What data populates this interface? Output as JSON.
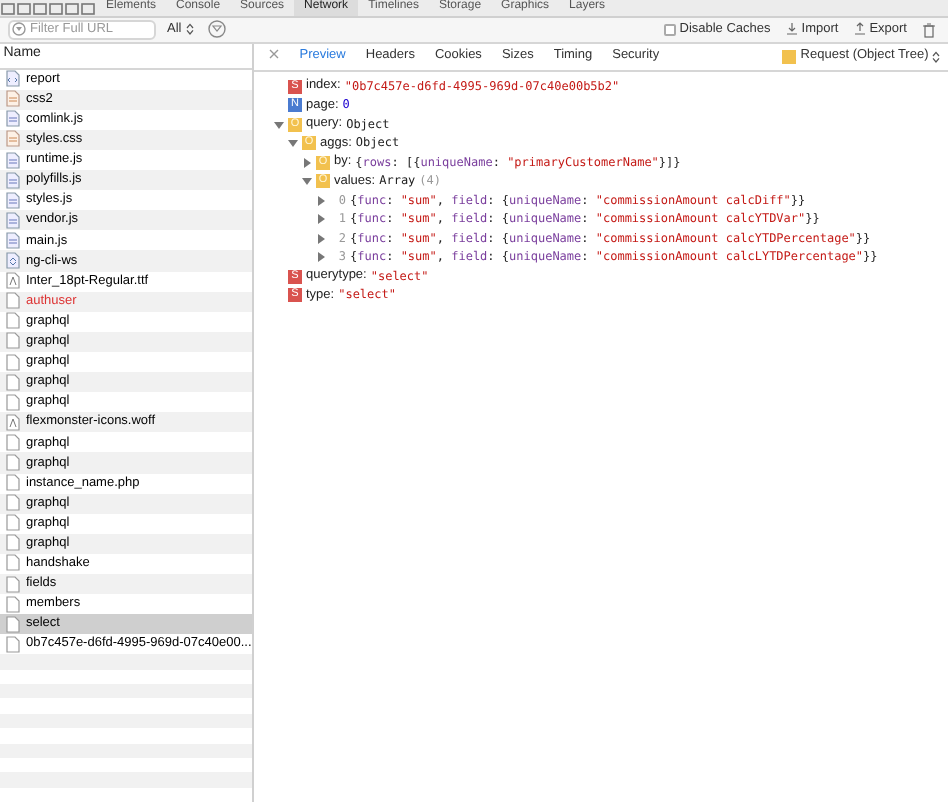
{
  "top_tabs": [
    {
      "label": "Elements",
      "selected": false
    },
    {
      "label": "Console",
      "selected": false
    },
    {
      "label": "Sources",
      "selected": false
    },
    {
      "label": "Network",
      "selected": true
    },
    {
      "label": "Timelines",
      "selected": false
    },
    {
      "label": "Storage",
      "selected": false
    },
    {
      "label": "Graphics",
      "selected": false
    },
    {
      "label": "Layers",
      "selected": false
    }
  ],
  "toolbar": {
    "filter": {
      "placeholder": "Filter Full URL"
    },
    "type_select": "All",
    "disable_caches": {
      "label": "Disable Caches",
      "checked": false
    },
    "import": "Import",
    "export": "Export"
  },
  "requests_header": "Name",
  "requests": [
    {
      "name": "report",
      "kind": "doc",
      "failed": false,
      "selected": false
    },
    {
      "name": "css2",
      "kind": "css",
      "failed": false,
      "selected": false
    },
    {
      "name": "comlink.js",
      "kind": "js",
      "failed": false,
      "selected": false
    },
    {
      "name": "styles.css",
      "kind": "css",
      "failed": false,
      "selected": false
    },
    {
      "name": "runtime.js",
      "kind": "js",
      "failed": false,
      "selected": false
    },
    {
      "name": "polyfills.js",
      "kind": "js",
      "failed": false,
      "selected": false
    },
    {
      "name": "styles.js",
      "kind": "js",
      "failed": false,
      "selected": false
    },
    {
      "name": "vendor.js",
      "kind": "js",
      "failed": false,
      "selected": false
    },
    {
      "name": "main.js",
      "kind": "js",
      "failed": false,
      "selected": false
    },
    {
      "name": "ng-cli-ws",
      "kind": "ws",
      "failed": false,
      "selected": false
    },
    {
      "name": "Inter_18pt-Regular.ttf",
      "kind": "font",
      "failed": false,
      "selected": false
    },
    {
      "name": "authuser",
      "kind": "plain",
      "failed": true,
      "selected": false
    },
    {
      "name": "graphql",
      "kind": "plain",
      "failed": false,
      "selected": false
    },
    {
      "name": "graphql",
      "kind": "plain",
      "failed": false,
      "selected": false
    },
    {
      "name": "graphql",
      "kind": "plain",
      "failed": false,
      "selected": false
    },
    {
      "name": "graphql",
      "kind": "plain",
      "failed": false,
      "selected": false
    },
    {
      "name": "graphql",
      "kind": "plain",
      "failed": false,
      "selected": false
    },
    {
      "name": "flexmonster-icons.woff",
      "kind": "font",
      "failed": false,
      "selected": false
    },
    {
      "name": "graphql",
      "kind": "plain",
      "failed": false,
      "selected": false
    },
    {
      "name": "graphql",
      "kind": "plain",
      "failed": false,
      "selected": false
    },
    {
      "name": "instance_name.php",
      "kind": "plain",
      "failed": false,
      "selected": false
    },
    {
      "name": "graphql",
      "kind": "plain",
      "failed": false,
      "selected": false
    },
    {
      "name": "graphql",
      "kind": "plain",
      "failed": false,
      "selected": false
    },
    {
      "name": "graphql",
      "kind": "plain",
      "failed": false,
      "selected": false
    },
    {
      "name": "handshake",
      "kind": "plain",
      "failed": false,
      "selected": false
    },
    {
      "name": "fields",
      "kind": "plain",
      "failed": false,
      "selected": false
    },
    {
      "name": "members",
      "kind": "plain",
      "failed": false,
      "selected": false
    },
    {
      "name": "select",
      "kind": "plain",
      "failed": false,
      "selected": true
    },
    {
      "name": "0b7c457e-d6fd-4995-969d-07c40e00...",
      "kind": "plain",
      "failed": false,
      "selected": false
    }
  ],
  "detail_tabs": [
    {
      "label": "Preview",
      "selected": true
    },
    {
      "label": "Headers",
      "selected": false
    },
    {
      "label": "Cookies",
      "selected": false
    },
    {
      "label": "Sizes",
      "selected": false
    },
    {
      "label": "Timing",
      "selected": false
    },
    {
      "label": "Security",
      "selected": false
    }
  ],
  "view_select": "Request (Object Tree)",
  "tree": [
    {
      "type": "S",
      "key": "index:",
      "value": "\"0b7c457e-d6fd-4995-969d-07c40e00b5b2\""
    },
    {
      "type": "N",
      "key": "page:",
      "value": "0"
    },
    {
      "type": "O",
      "key": "query:",
      "value": "Object",
      "expanded": true,
      "children": [
        {
          "type": "O",
          "key": "aggs:",
          "value": "Object",
          "expanded": true,
          "children": [
            {
              "type": "O",
              "key": "by:",
              "value": "{rows: [{uniqueName: \"primaryCustomerName\"}]}",
              "expanded": false
            },
            {
              "type": "O",
              "key": "values:",
              "value": "Array",
              "count": "(4)",
              "expanded": true,
              "children": [
                {
                  "index": "0",
                  "value": "{func: \"sum\", field: {uniqueName: \"commissionAmount calcDiff\"}}",
                  "expanded": false
                },
                {
                  "index": "1",
                  "value": "{func: \"sum\", field: {uniqueName: \"commissionAmount calcYTDVar\"}}",
                  "expanded": false
                },
                {
                  "index": "2",
                  "value": "{func: \"sum\", field: {uniqueName: \"commissionAmount calcYTDPercentage\"}}",
                  "expanded": false
                },
                {
                  "index": "3",
                  "value": "{func: \"sum\", field: {uniqueName: \"commissionAmount calcLYTDPercentage\"}}",
                  "expanded": false
                }
              ]
            }
          ]
        }
      ]
    },
    {
      "type": "S",
      "key": "querytype:",
      "value": "\"select\""
    },
    {
      "type": "S",
      "key": "type:",
      "value": "\"select\""
    }
  ]
}
